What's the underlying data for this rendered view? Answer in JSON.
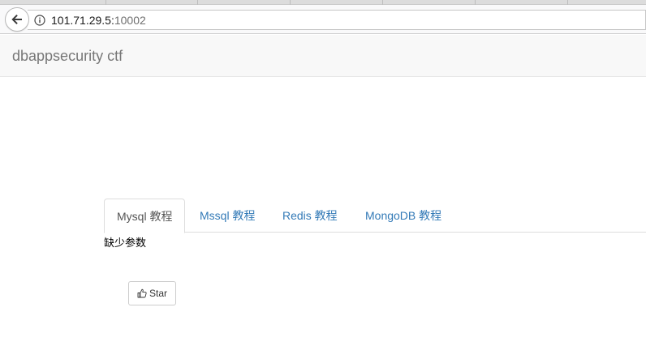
{
  "browser": {
    "url_host": "101.71.29.5:",
    "url_port": "10002"
  },
  "navbar": {
    "brand": "dbappsecurity ctf"
  },
  "tabs": [
    {
      "label": "Mysql 教程",
      "active": true
    },
    {
      "label": "Mssql 教程",
      "active": false
    },
    {
      "label": "Redis 教程",
      "active": false
    },
    {
      "label": "MongoDB 教程",
      "active": false
    }
  ],
  "content": {
    "message": "缺少参数"
  },
  "star_button": {
    "label": "Star"
  },
  "colors": {
    "link": "#337ab7",
    "active_tab_text": "#555555",
    "navbar_bg": "#f8f8f8"
  }
}
